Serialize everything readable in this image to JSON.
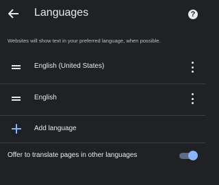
{
  "header": {
    "title": "Languages",
    "back_icon": "arrow-left-icon",
    "help_icon": "help-icon",
    "help_glyph": "?"
  },
  "description": "Websites will show text in your preferred language, when possible.",
  "languages": [
    {
      "label": "English (United States)"
    },
    {
      "label": "English"
    }
  ],
  "add_language": {
    "label": "Add language",
    "accent": "#8ab4f8"
  },
  "translate": {
    "label": "Offer to translate pages in other languages",
    "enabled": true
  },
  "colors": {
    "background": "#202124",
    "text": "#e8eaed",
    "secondary_text": "#bdc1c6",
    "divider": "#3c4043",
    "accent": "#8ab4f8"
  }
}
